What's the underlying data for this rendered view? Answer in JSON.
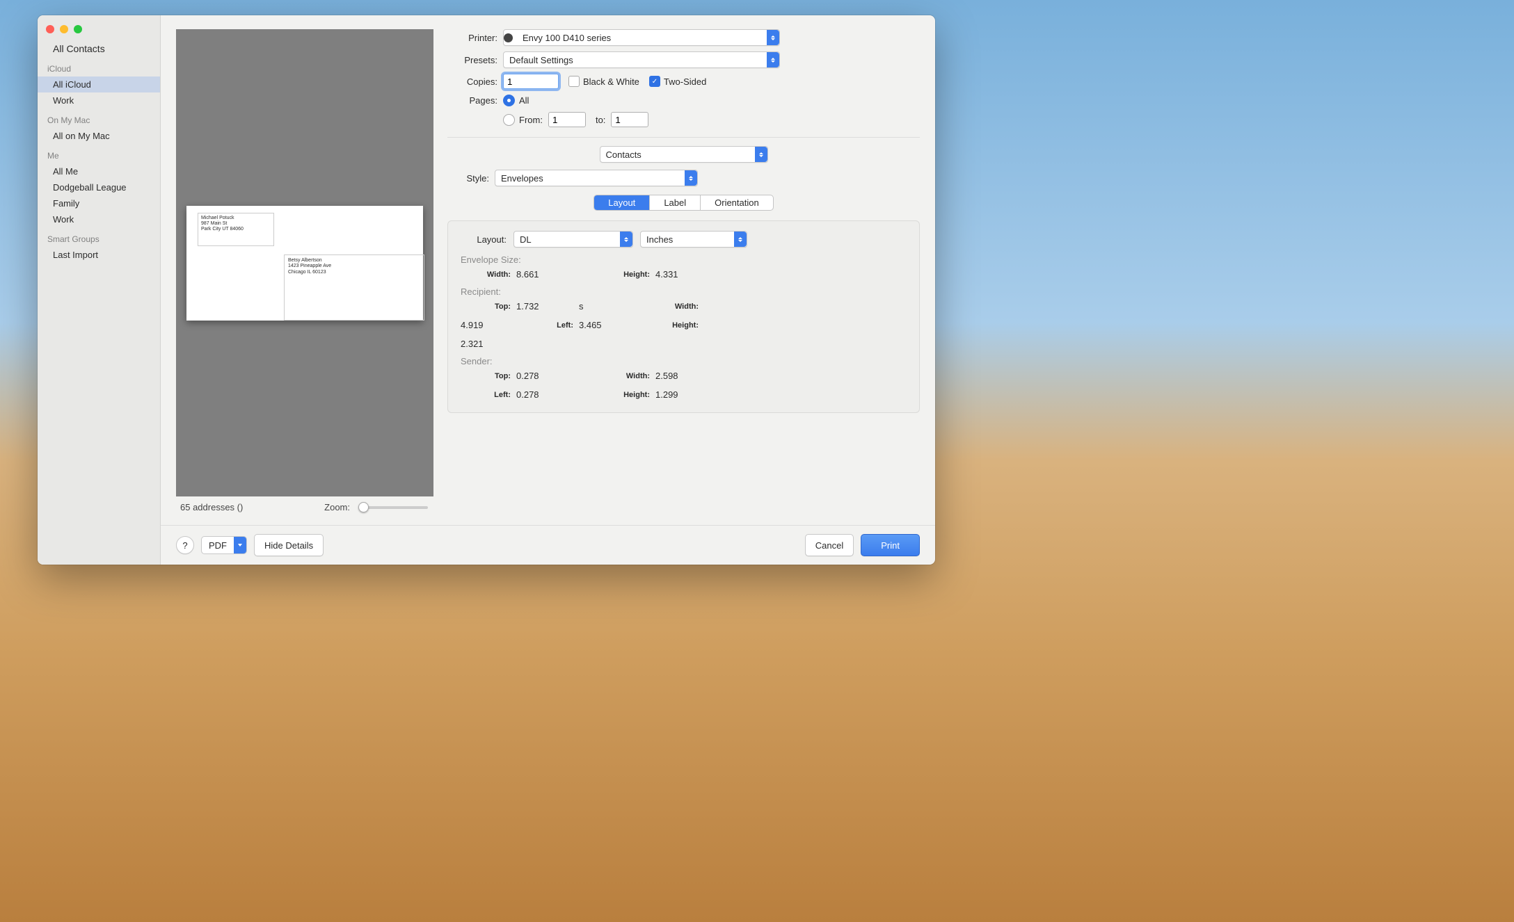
{
  "traffic": {
    "close": "#ff5f57",
    "min": "#febc2e",
    "max": "#28c840"
  },
  "sidebar": {
    "all_contacts": "All Contacts",
    "sections": [
      {
        "header": "iCloud",
        "items": [
          {
            "label": "All iCloud",
            "selected": true
          },
          {
            "label": "Work"
          }
        ]
      },
      {
        "header": "On My Mac",
        "items": [
          {
            "label": "All on My Mac"
          }
        ]
      },
      {
        "header": "Me",
        "items": [
          {
            "label": "All Me"
          },
          {
            "label": "Dodgeball League"
          },
          {
            "label": "Family"
          },
          {
            "label": "Work"
          }
        ]
      },
      {
        "header": "Smart Groups",
        "items": [
          {
            "label": "Last Import"
          }
        ]
      }
    ]
  },
  "preview": {
    "sender": {
      "name": "Michael Potuck",
      "line2": "987 Main St",
      "line3": "Park City UT 84060"
    },
    "recipient": {
      "name": "Betsy Albertson",
      "line2": "1423 Pineapple Ave",
      "line3": "Chicago IL 60123"
    },
    "status": "65 addresses ()",
    "zoom_label": "Zoom:"
  },
  "print": {
    "printer_label": "Printer:",
    "printer": "Envy 100 D410 series",
    "presets_label": "Presets:",
    "presets": "Default Settings",
    "copies_label": "Copies:",
    "copies": "1",
    "bw_label": "Black & White",
    "bw": false,
    "ts_label": "Two-Sided",
    "ts": true,
    "pages_label": "Pages:",
    "pages_all": "All",
    "pages_from": "From:",
    "pages_to": "to:",
    "from_v": "1",
    "to_v": "1",
    "app_section": "Contacts",
    "style_label": "Style:",
    "style": "Envelopes",
    "tabs": {
      "layout": "Layout",
      "label": "Label",
      "orient": "Orientation"
    },
    "layout": {
      "layout_label": "Layout:",
      "layout_sel": "DL",
      "units": "Inches",
      "env_size": "Envelope Size:",
      "recipient": "Recipient:",
      "sender": "Sender:",
      "k_width": "Width:",
      "k_height": "Height:",
      "k_top": "Top:",
      "k_left": "Left:",
      "env": {
        "width": "8.661",
        "height": "4.331"
      },
      "recip": {
        "top": "1.732",
        "left": "3.465",
        "width": "4.919",
        "height": "2.321"
      },
      "send": {
        "top": "0.278",
        "left": "0.278",
        "width": "2.598",
        "height": "1.299"
      }
    }
  },
  "footer": {
    "help": "?",
    "pdf": "PDF",
    "hide": "Hide Details",
    "cancel": "Cancel",
    "print": "Print"
  }
}
